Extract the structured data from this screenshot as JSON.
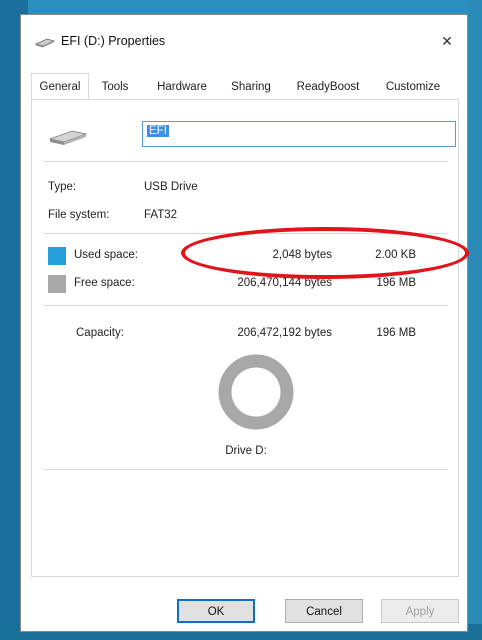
{
  "window": {
    "title": "EFI (D:) Properties",
    "close_glyph": "✕"
  },
  "tabs": [
    {
      "label": "General",
      "active": true
    },
    {
      "label": "Tools"
    },
    {
      "label": "Hardware"
    },
    {
      "label": "Sharing"
    },
    {
      "label": "ReadyBoost"
    },
    {
      "label": "Customize"
    }
  ],
  "general": {
    "name_value": "EFI",
    "type_label": "Type:",
    "type_value": "USB Drive",
    "fs_label": "File system:",
    "fs_value": "FAT32",
    "used": {
      "label": "Used space:",
      "bytes": "2,048 bytes",
      "size": "2.00 KB",
      "color": "#26a0da"
    },
    "free": {
      "label": "Free space:",
      "bytes": "206,470,144 bytes",
      "size": "196 MB",
      "color": "#a8a8a8"
    },
    "capacity": {
      "label": "Capacity:",
      "bytes": "206,472,192 bytes",
      "size": "196 MB"
    },
    "used_fraction": 1e-05,
    "drive_label": "Drive D:"
  },
  "buttons": {
    "ok": "OK",
    "cancel": "Cancel",
    "apply": "Apply"
  },
  "annotation": {
    "color": "#e0141a"
  }
}
